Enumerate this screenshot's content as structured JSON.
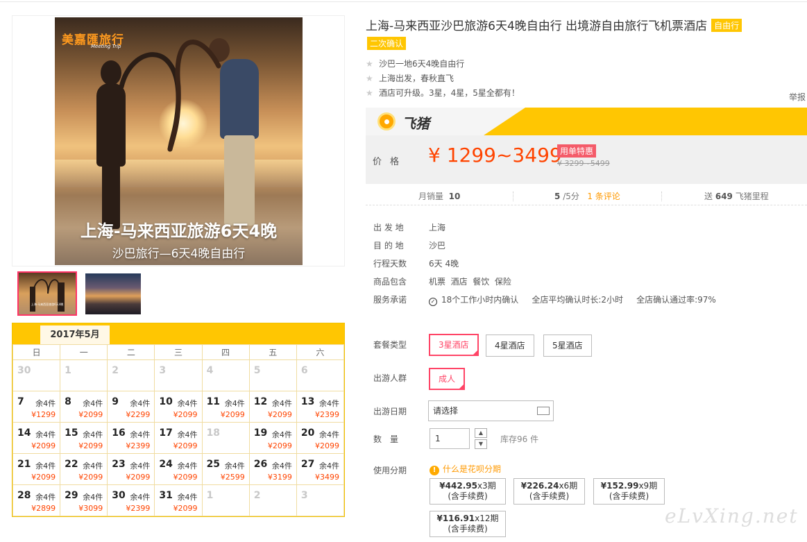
{
  "gallery": {
    "brand": "美嘉匯旅行",
    "brand_sub": "Meeting Trip",
    "photo_title": "上海-马来西亚旅游6天4晚",
    "photo_subtitle": "沙巴旅行—6天4晚自由行",
    "thumb_text": "上海-马来西亚旅游6天4晚"
  },
  "calendar": {
    "month": "2017年5月",
    "weekdays": [
      "日",
      "一",
      "二",
      "三",
      "四",
      "五",
      "六"
    ],
    "weeks": [
      [
        {
          "d": "30",
          "g": true
        },
        {
          "d": "1",
          "g": true
        },
        {
          "d": "2",
          "g": true
        },
        {
          "d": "3",
          "g": true
        },
        {
          "d": "4",
          "g": true
        },
        {
          "d": "5",
          "g": true
        },
        {
          "d": "6",
          "g": true
        }
      ],
      [
        {
          "d": "7",
          "l": "余4件",
          "p": "¥1299"
        },
        {
          "d": "8",
          "l": "余4件",
          "p": "¥2099"
        },
        {
          "d": "9",
          "l": "余4件",
          "p": "¥2299"
        },
        {
          "d": "10",
          "l": "余4件",
          "p": "¥2099"
        },
        {
          "d": "11",
          "l": "余4件",
          "p": "¥2099"
        },
        {
          "d": "12",
          "l": "余4件",
          "p": "¥2099"
        },
        {
          "d": "13",
          "l": "余4件",
          "p": "¥2399"
        }
      ],
      [
        {
          "d": "14",
          "l": "余4件",
          "p": "¥2099"
        },
        {
          "d": "15",
          "l": "余4件",
          "p": "¥2099"
        },
        {
          "d": "16",
          "l": "余4件",
          "p": "¥2399"
        },
        {
          "d": "17",
          "l": "余4件",
          "p": "¥2099"
        },
        {
          "d": "18",
          "g": true
        },
        {
          "d": "19",
          "l": "余4件",
          "p": "¥2099"
        },
        {
          "d": "20",
          "l": "余4件",
          "p": "¥2099"
        }
      ],
      [
        {
          "d": "21",
          "l": "余4件",
          "p": "¥2099"
        },
        {
          "d": "22",
          "l": "余4件",
          "p": "¥2099"
        },
        {
          "d": "23",
          "l": "余4件",
          "p": "¥2099"
        },
        {
          "d": "24",
          "l": "余4件",
          "p": "¥2099"
        },
        {
          "d": "25",
          "l": "余4件",
          "p": "¥2599"
        },
        {
          "d": "26",
          "l": "余4件",
          "p": "¥3199"
        },
        {
          "d": "27",
          "l": "余4件",
          "p": "¥3499"
        }
      ],
      [
        {
          "d": "28",
          "l": "余4件",
          "p": "¥2899"
        },
        {
          "d": "29",
          "l": "余4件",
          "p": "¥3099"
        },
        {
          "d": "30",
          "l": "余4件",
          "p": "¥2399"
        },
        {
          "d": "31",
          "l": "余4件",
          "p": "¥2099"
        },
        {
          "d": "1",
          "g": true
        },
        {
          "d": "2",
          "g": true
        },
        {
          "d": "3",
          "g": true
        }
      ]
    ]
  },
  "product": {
    "title": "上海-马来西亚沙巴旅游6天4晚自由行 出境游自由旅行飞机票酒店",
    "tag_free": "自由行",
    "tag_confirm": "二次确认",
    "features": [
      "沙巴一地6天4晚自由行",
      "上海出发，春秋直飞",
      "酒店可升级。3星，4星，5星全都有！"
    ],
    "report": "举报"
  },
  "fliggy": {
    "name": "飞猪"
  },
  "price": {
    "label": "价格",
    "value": "¥ 1299~3499",
    "promo": "用单特惠",
    "original": "¥ 3299~5499"
  },
  "stats": {
    "sales_label": "月销量",
    "sales": "10",
    "rating": "5",
    "rating_unit": "/5分",
    "reviews": "1 条评论",
    "miles_prefix": "送",
    "miles": "649",
    "miles_suffix": "飞猪里程"
  },
  "info": [
    {
      "label": "出 发 地",
      "value": "上海"
    },
    {
      "label": "目 的 地",
      "value": "沙巴"
    },
    {
      "label": "行程天数",
      "value": "6天 4晚"
    },
    {
      "label": "商品包含",
      "value": "机票  酒店  餐饮  保险"
    },
    {
      "label": "服务承诺",
      "value": "18个工作小时内确认     全店平均确认时长:2小时     全店确认通过率:97%"
    }
  ],
  "options": {
    "package_label": "套餐类型",
    "packages": [
      "3星酒店",
      "4星酒店",
      "5星酒店"
    ],
    "group_label": "出游人群",
    "group": "成人",
    "date_label": "出游日期",
    "date_placeholder": "请选择",
    "qty_label": "数　量",
    "qty": "1",
    "stock": "库存96 件",
    "installment_label": "使用分期",
    "huabei_link": "什么是花呗分期",
    "installments": [
      {
        "amount": "¥442.95",
        "periods": "x3期",
        "fee": "(含手续费)"
      },
      {
        "amount": "¥226.24",
        "periods": "x6期",
        "fee": "(含手续费)"
      },
      {
        "amount": "¥152.99",
        "periods": "x9期",
        "fee": "(含手续费)"
      },
      {
        "amount": "¥116.91",
        "periods": "x12期",
        "fee": "(含手续费)"
      }
    ]
  },
  "watermark": "eLvXing.net",
  "colors": {
    "accent": "#ffc602",
    "price": "#ff4400",
    "selected": "#ff4466"
  }
}
